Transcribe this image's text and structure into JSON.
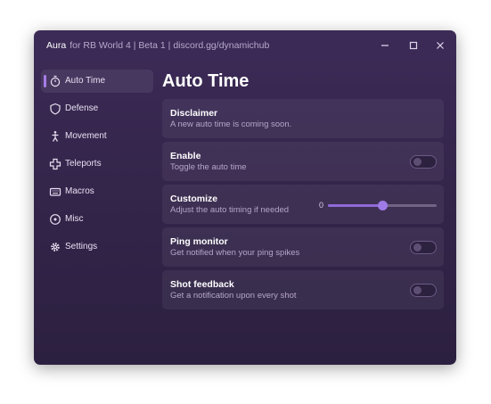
{
  "titlebar": {
    "app_name": "Aura",
    "subtitle": "for RB World 4 | Beta 1 | discord.gg/dynamichub",
    "minimize_icon": "minimize-icon",
    "maximize_icon": "maximize-icon",
    "close_icon": "close-icon"
  },
  "sidebar": {
    "items": [
      {
        "label": "Auto Time",
        "icon": "stopwatch-icon",
        "active": true
      },
      {
        "label": "Defense",
        "icon": "shield-icon"
      },
      {
        "label": "Movement",
        "icon": "running-person-icon"
      },
      {
        "label": "Teleports",
        "icon": "teleport-icon"
      },
      {
        "label": "Macros",
        "icon": "keyboard-icon"
      },
      {
        "label": "Misc",
        "icon": "circle-dot-icon"
      },
      {
        "label": "Settings",
        "icon": "gear-icon"
      }
    ]
  },
  "main": {
    "title": "Auto Time",
    "disclaimer": {
      "title": "Disclaimer",
      "desc": "A new auto time is coming soon."
    },
    "enable": {
      "title": "Enable",
      "desc": "Toggle the auto time",
      "on": false
    },
    "customize": {
      "title": "Customize",
      "desc": "Adjust the auto timing if needed",
      "value": "0",
      "slider_fraction": 0.5
    },
    "ping_monitor": {
      "title": "Ping monitor",
      "desc": "Get notified when your ping spikes",
      "on": false
    },
    "shot_feedback": {
      "title": "Shot feedback",
      "desc": "Get a notification upon every shot",
      "on": false
    }
  },
  "colors": {
    "accent": "#a77de8",
    "window_bg": "#3c2b57"
  }
}
